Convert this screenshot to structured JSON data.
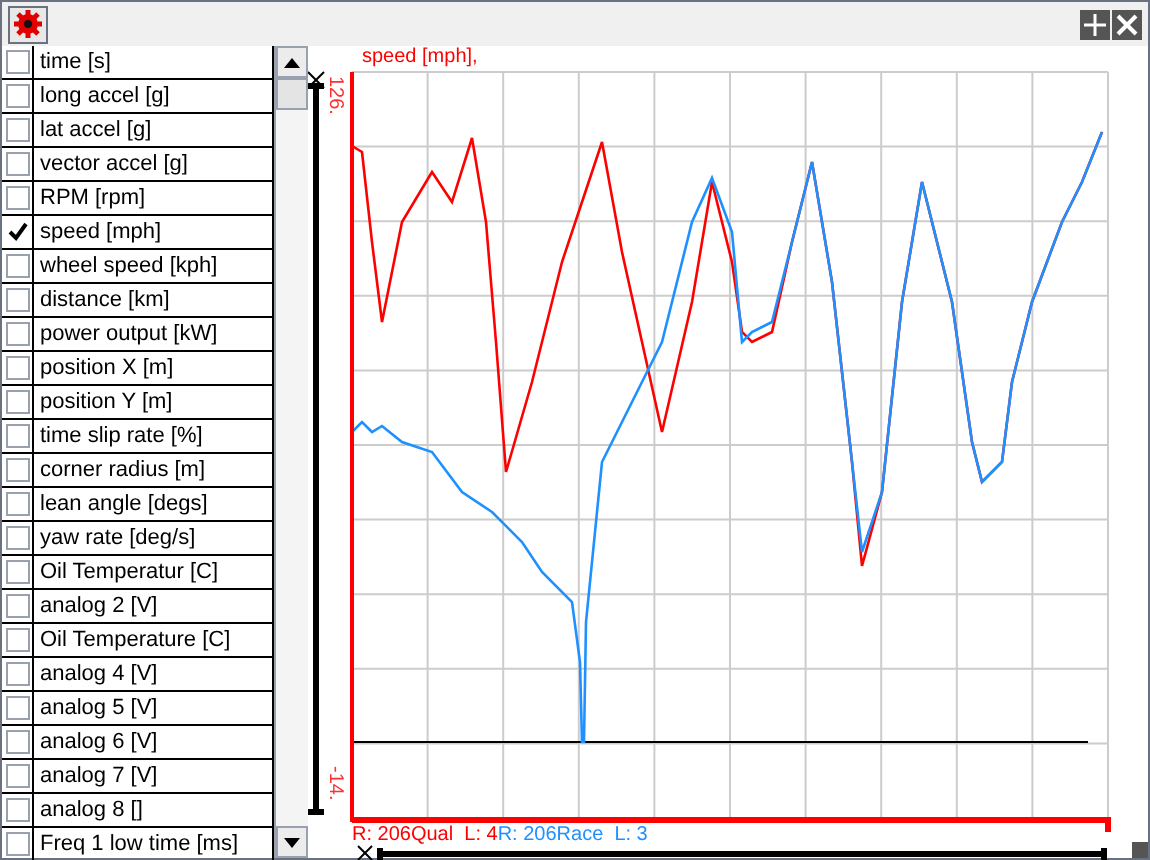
{
  "channels": [
    {
      "label": "time [s]",
      "checked": false
    },
    {
      "label": "long accel [g]",
      "checked": false
    },
    {
      "label": "lat accel [g]",
      "checked": false
    },
    {
      "label": "vector accel [g]",
      "checked": false
    },
    {
      "label": "RPM [rpm]",
      "checked": false
    },
    {
      "label": "speed [mph]",
      "checked": true
    },
    {
      "label": "wheel speed [kph]",
      "checked": false
    },
    {
      "label": "distance [km]",
      "checked": false
    },
    {
      "label": "power output [kW]",
      "checked": false
    },
    {
      "label": "position X [m]",
      "checked": false
    },
    {
      "label": "position Y [m]",
      "checked": false
    },
    {
      "label": "time slip rate [%]",
      "checked": false
    },
    {
      "label": "corner radius [m]",
      "checked": false
    },
    {
      "label": "lean angle [degs]",
      "checked": false
    },
    {
      "label": "yaw rate [deg/s]",
      "checked": false
    },
    {
      "label": "Oil Temperatur [C]",
      "checked": false
    },
    {
      "label": "analog 2 [V]",
      "checked": false
    },
    {
      "label": "Oil Temperature [C]",
      "checked": false
    },
    {
      "label": "analog 4 [V]",
      "checked": false
    },
    {
      "label": "analog 5 [V]",
      "checked": false
    },
    {
      "label": "analog 6 [V]",
      "checked": false
    },
    {
      "label": "analog 7 [V]",
      "checked": false
    },
    {
      "label": "analog 8 []",
      "checked": false
    },
    {
      "label": "Freq 1 low time [ms]",
      "checked": false
    }
  ],
  "chart": {
    "title": "speed [mph],",
    "y_max_label": "126.",
    "y_min_label": "-14.",
    "legend": [
      {
        "text": "R: 206Qual  L: 4",
        "color": "#ff0000"
      },
      {
        "text": "R: 206Race  L: 3",
        "color": "#1e90ff"
      }
    ]
  }
}
